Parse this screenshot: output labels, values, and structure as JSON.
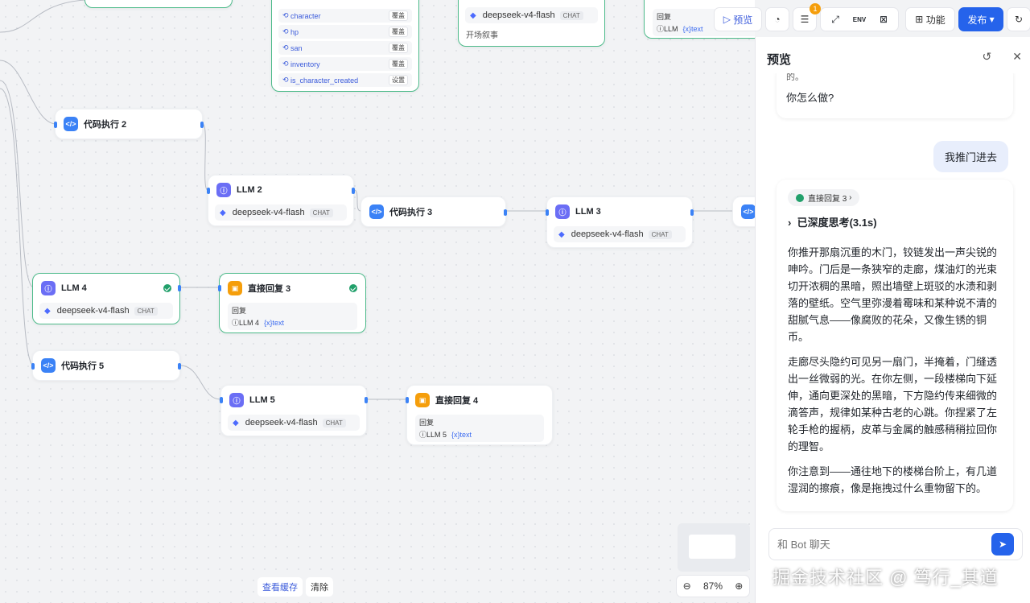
{
  "canvas": {
    "var_rows": [
      {
        "name": "character",
        "action": "覆盖"
      },
      {
        "name": "hp",
        "action": "覆盖"
      },
      {
        "name": "san",
        "action": "覆盖"
      },
      {
        "name": "inventory",
        "action": "覆盖"
      },
      {
        "name": "is_character_created",
        "action": "设置"
      }
    ],
    "top_llm_model": "deepseek-v4-flash",
    "top_llm_tag": "CHAT",
    "top_llm_footer": "开场叙事",
    "top_reply_label": "回复",
    "top_reply_ref": "LLM",
    "top_reply_var": "{x}text",
    "nodes": {
      "code2": "代码执行 2",
      "llm2": "LLM 2",
      "code3": "代码执行 3",
      "llm3": "LLM 3",
      "code_partial": "代",
      "llm4": "LLM 4",
      "reply3": "直接回复 3",
      "code5": "代码执行 5",
      "llm5": "LLM 5",
      "reply4": "直接回复 4"
    },
    "model": "deepseek-v4-flash",
    "chat_tag": "CHAT",
    "reply_label": "回复",
    "reply3_ref": "LLM 4",
    "reply4_ref": "LLM 5",
    "var_text": "{x}text",
    "view_cache": "查看缓存",
    "clear": "清除",
    "zoom_level": "87%"
  },
  "toolbar": {
    "preview": "预览",
    "badge_count": "1",
    "env": "ENV",
    "features": "功能",
    "publish": "发布"
  },
  "panel": {
    "title": "预览",
    "prev_tail": "的。",
    "prev_question": "你怎么做?",
    "user_message": "我推门进去",
    "reply_chip": "直接回复 3",
    "thinking": "已深度思考(3.1s)",
    "paragraphs": [
      "你推开那扇沉重的木门，铰链发出一声尖锐的呻吟。门后是一条狭窄的走廊，煤油灯的光束切开浓稠的黑暗，照出墙壁上斑驳的水渍和剥落的壁纸。空气里弥漫着霉味和某种说不清的甜腻气息——像腐败的花朵，又像生锈的铜币。",
      "走廊尽头隐约可见另一扇门，半掩着，门缝透出一丝微弱的光。在你左侧，一段楼梯向下延伸，通向更深处的黑暗，下方隐约传来细微的滴答声，规律如某种古老的心跳。你捏紧了左轮手枪的握柄，皮革与金属的触感稍稍拉回你的理智。",
      "你注意到——通往地下的楼梯台阶上，有几道湿润的擦痕，像是拖拽过什么重物留下的。"
    ],
    "input_placeholder": "和 Bot 聊天"
  },
  "watermark": "掘金技术社区 @ 笃行_其道"
}
